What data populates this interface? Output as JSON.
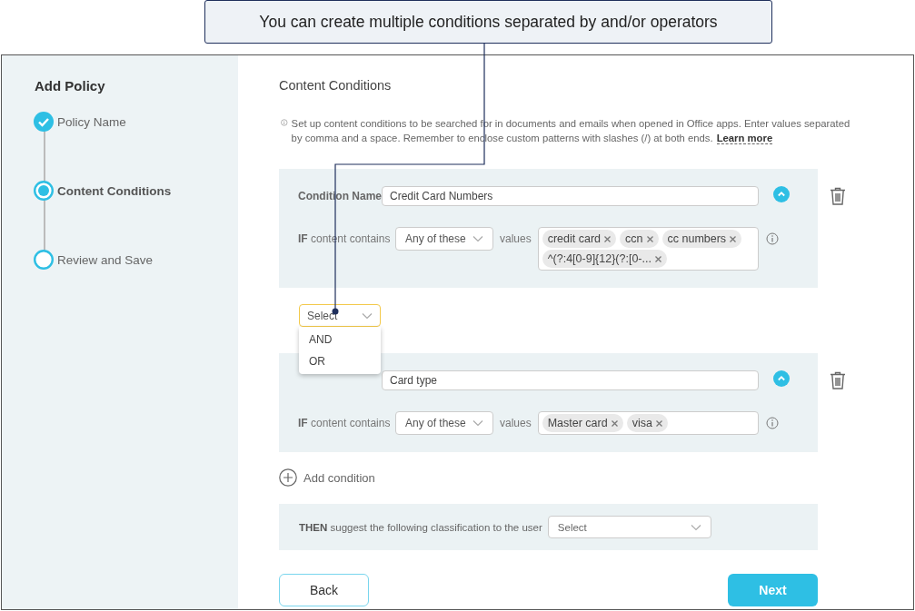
{
  "callout": {
    "text": "You can create multiple conditions separated by and/or operators"
  },
  "sidebar": {
    "title": "Add Policy",
    "steps": [
      {
        "label": "Policy Name",
        "kind": "done"
      },
      {
        "label": "Content Conditions",
        "kind": "current"
      },
      {
        "label": "Review and Save",
        "kind": "pending"
      }
    ]
  },
  "main": {
    "title": "Content Conditions",
    "description": "Set up content conditions to be searched for in documents and emails when opened in Office apps. Enter values separated by comma and a space. Remember to enclose custom patterns with slashes (/) at both ends.",
    "learn_more": "Learn more",
    "conditions": [
      {
        "name_label": "Condition Name",
        "name": "Credit Card Numbers",
        "if_label": "**IF** content contains",
        "match": "Any of these",
        "values_label": "values",
        "tags": [
          "credit card",
          "ccn",
          "cc numbers",
          "^(?:4[0-9]{12}(?:[0-..."
        ]
      },
      {
        "name": "Card type",
        "if_label": "**IF** content contains",
        "match": "Any of these",
        "values_label": "values",
        "tags": [
          "Master card",
          "visa"
        ]
      }
    ],
    "operator": {
      "value": "Select",
      "expanded": true,
      "options": [
        {
          "label": "AND"
        },
        {
          "label": "OR"
        }
      ]
    },
    "add_condition": "Add condition",
    "then": {
      "label": "**THEN** suggest the following classification to the user",
      "value": "Select"
    },
    "buttons": {
      "back": "Back",
      "next": "Next"
    }
  }
}
